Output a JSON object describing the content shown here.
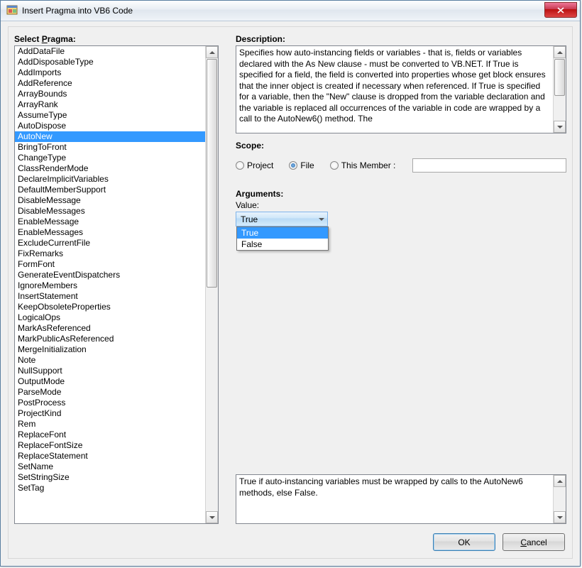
{
  "window": {
    "title": "Insert Pragma into VB6 Code"
  },
  "labels": {
    "select_pragma_pre": "Select ",
    "select_pragma_u": "P",
    "select_pragma_post": "ragma:",
    "description": "Description:",
    "scope": "Scope:",
    "arguments": "Arguments:",
    "value": "Value:"
  },
  "pragmas": [
    "AddDataFile",
    "AddDisposableType",
    "AddImports",
    "AddReference",
    "ArrayBounds",
    "ArrayRank",
    "AssumeType",
    "AutoDispose",
    "AutoNew",
    "BringToFront",
    "ChangeType",
    "ClassRenderMode",
    "DeclareImplicitVariables",
    "DefaultMemberSupport",
    "DisableMessage",
    "DisableMessages",
    "EnableMessage",
    "EnableMessages",
    "ExcludeCurrentFile",
    "FixRemarks",
    "FormFont",
    "GenerateEventDispatchers",
    "IgnoreMembers",
    "InsertStatement",
    "KeepObsoleteProperties",
    "LogicalOps",
    "MarkAsReferenced",
    "MarkPublicAsReferenced",
    "MergeInitialization",
    "Note",
    "NullSupport",
    "OutputMode",
    "ParseMode",
    "PostProcess",
    "ProjectKind",
    "Rem",
    "ReplaceFont",
    "ReplaceFontSize",
    "ReplaceStatement",
    "SetName",
    "SetStringSize",
    "SetTag"
  ],
  "selected_pragma_index": 8,
  "description_text": "Specifies how auto-instancing fields or variables - that is, fields or variables declared with the As New clause - must be converted to VB.NET. If True is specified for a field, the field is converted into properties whose get block ensures that the inner object is created if necessary when referenced. If True is specified for a variable, then the \"New\" clause is dropped from the variable declaration and the variable is replaced all occurrences of the variable in code are wrapped by a call to the AutoNew6() method. The",
  "scope": {
    "options": {
      "project": "Project",
      "file": "File",
      "this_member": "This Member :"
    },
    "selected": "file",
    "member_value": ""
  },
  "value_combo": {
    "selected": "True",
    "options": [
      "True",
      "False"
    ],
    "highlighted_index": 0
  },
  "footer_text": "True if auto-instancing variables must be wrapped by calls to the AutoNew6 methods, else False.",
  "buttons": {
    "ok": "OK",
    "cancel_pre": "",
    "cancel_u": "C",
    "cancel_post": "ancel"
  }
}
